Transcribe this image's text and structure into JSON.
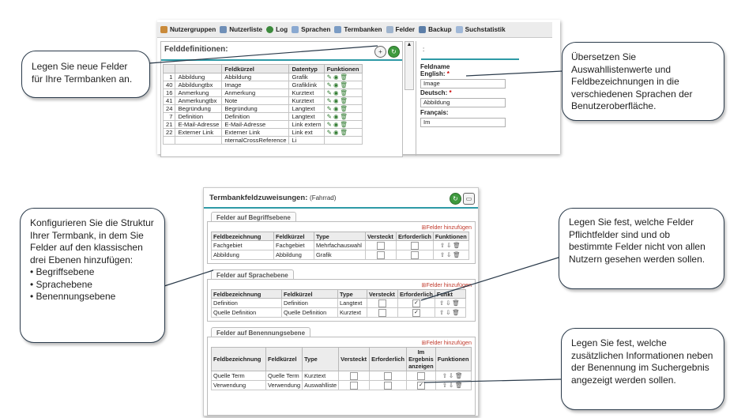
{
  "toolbar": {
    "items": [
      {
        "label": "Nutzergruppen",
        "icon": "users-icon"
      },
      {
        "label": "Nutzerliste",
        "icon": "list-icon"
      },
      {
        "label": "Log",
        "icon": "clock-icon"
      },
      {
        "label": "Sprachen",
        "icon": "language-icon"
      },
      {
        "label": "Termbanken",
        "icon": "database-icon"
      },
      {
        "label": "Felder",
        "icon": "fields-icon"
      },
      {
        "label": "Backup",
        "icon": "backup-icon"
      },
      {
        "label": "Suchstatistik",
        "icon": "stats-icon"
      }
    ]
  },
  "field_definitions": {
    "title": "Felddefinitionen:",
    "headers": [
      "Feldkürzel",
      "Datentyp",
      "Funktionen"
    ],
    "rows": [
      {
        "id": "1",
        "name": "Abbildung",
        "short": "Abbildung",
        "type": "Grafik"
      },
      {
        "id": "40",
        "name": "Abbildungtbx",
        "short": "Image",
        "type": "Grafiklink"
      },
      {
        "id": "16",
        "name": "Anmerkung",
        "short": "Anmerkung",
        "type": "Kurztext"
      },
      {
        "id": "41",
        "name": "Anmerkungtbx",
        "short": "Note",
        "type": "Kurztext"
      },
      {
        "id": "24",
        "name": "Begründung",
        "short": "Begründung",
        "type": "Langtext"
      },
      {
        "id": "7",
        "name": "Definition",
        "short": "Definition",
        "type": "Langtext"
      },
      {
        "id": "21",
        "name": "E-Mail-Adresse",
        "short": "E-Mail-Adresse",
        "type": "Link extern"
      },
      {
        "id": "22",
        "name": "Externer Link",
        "short": "Externer Link",
        "type": "Link ext"
      },
      {
        "id": "",
        "name": "",
        "short": "nternalCrossReference",
        "type": "Li"
      }
    ],
    "right": {
      "colon": ":",
      "section": "Feldname",
      "english_label": "English:",
      "english_value": "Image",
      "deutsch_label": "Deutsch:",
      "deutsch_value": "Abbildung",
      "francais_label": "Français:",
      "francais_value": "Im"
    }
  },
  "assignments": {
    "title": "Termbankfeldzuweisungen:",
    "subtitle": "(Fahrrad)",
    "add_label": "Felder hinzufügen",
    "concept": {
      "tab": "Felder auf Begriffsebene",
      "headers": [
        "Feldbezeichnung",
        "Feldkürzel",
        "Type",
        "Versteckt",
        "Erforderlich",
        "Funktionen"
      ],
      "rows": [
        {
          "name": "Fachgebiet",
          "short": "Fachgebiet",
          "type": "Mehrfachauswahl",
          "hidden": false,
          "required": false
        },
        {
          "name": "Abbildung",
          "short": "Abbildung",
          "type": "Grafik",
          "hidden": false,
          "required": false
        }
      ]
    },
    "language": {
      "tab": "Felder auf Sprachebene",
      "headers": [
        "Feldbezeichnung",
        "Feldkürzel",
        "Type",
        "Versteckt",
        "Erforderlich",
        "Funkt"
      ],
      "rows": [
        {
          "name": "Definition",
          "short": "Definition",
          "type": "Langtext",
          "hidden": false,
          "required": true
        },
        {
          "name": "Quelle Definition",
          "short": "Quelle Definition",
          "type": "Kurztext",
          "hidden": false,
          "required": true
        }
      ]
    },
    "term": {
      "tab": "Felder auf Benennungsebene",
      "headers": [
        "Feldbezeichnung",
        "Feldkürzel",
        "Type",
        "Versteckt",
        "Erforderlich",
        "Im Ergebnis anzeigen",
        "Funktionen"
      ],
      "rows": [
        {
          "name": "Quelle Term",
          "short": "Quelle Term",
          "type": "Kurztext",
          "hidden": false,
          "required": false,
          "show": false
        },
        {
          "name": "Verwendung",
          "short": "Verwendung",
          "type": "Auswahlliste",
          "hidden": false,
          "required": false,
          "show": true
        }
      ]
    }
  },
  "callouts": {
    "new_fields": "Legen Sie neue Felder für Ihre Termbanken an.",
    "translate": "Übersetzen Sie Auswahllistenwerte und Feldbezeichnungen in die verschiedenen Sprachen der Benutzeroberfläche.",
    "configure_intro": "Konfigurieren Sie die Struktur Ihrer Termbank, in dem Sie Felder auf den klassischen drei Ebenen hinzufügen:",
    "configure_bullets": [
      "Begriffsebene",
      "Sprachebene",
      "Benennungsebene"
    ],
    "required": "Legen Sie fest, welche Felder Pflichtfelder sind und ob bestimmte Felder nicht von allen Nutzern gesehen werden sollen.",
    "results": "Legen Sie fest, welche zusätzlichen Informationen neben der Benennung im Suchergebnis angezeigt werden sollen."
  },
  "colors": {
    "accent": "#2e9aa6",
    "link": "#c0392b",
    "callout_border": "#2a3a4a"
  }
}
